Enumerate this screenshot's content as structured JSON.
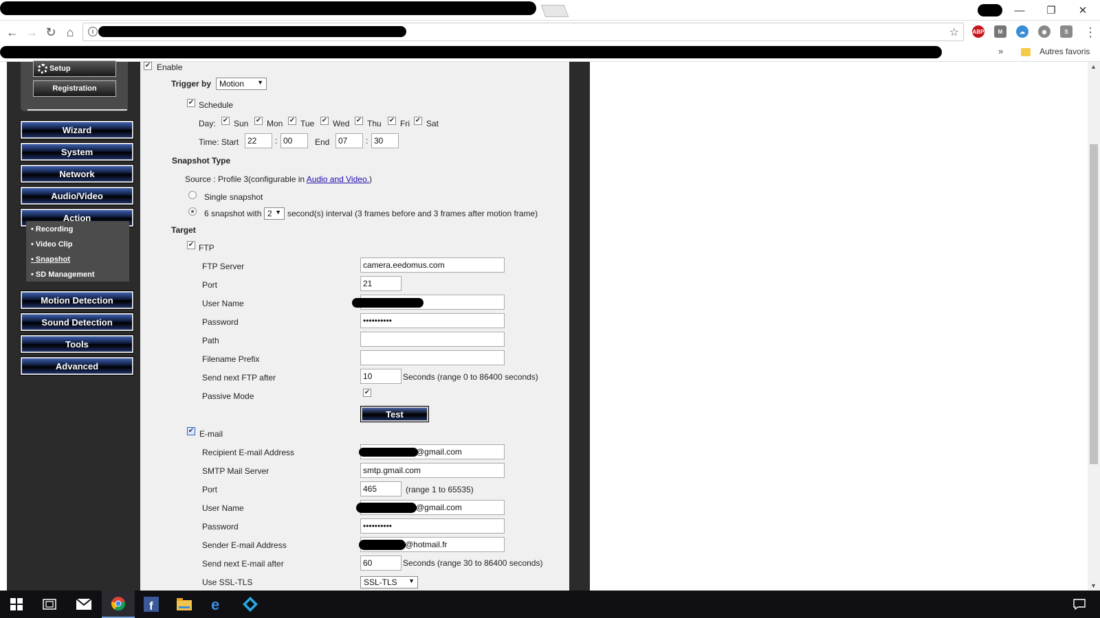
{
  "browser": {
    "bookmarks_more": "»",
    "bookmarks_folder_label": "Autres favoris",
    "window": {
      "minimize": "—",
      "restore": "❐",
      "close": "✕"
    },
    "nav": {
      "back": "←",
      "forward": "→",
      "reload": "↻",
      "home": "⌂",
      "star": "☆",
      "menu": "⋮"
    },
    "extensions": [
      {
        "name": "abp-icon",
        "text": "ABP",
        "color": "#c4161c"
      },
      {
        "name": "gmail-icon",
        "text": "M",
        "color": "#777777"
      },
      {
        "name": "cloud-icon",
        "text": "☁",
        "color": "#3a8ed6"
      },
      {
        "name": "eye-icon",
        "text": "◉",
        "color": "#888888"
      },
      {
        "name": "s-extension-icon",
        "text": "S",
        "color": "#8a8a8a"
      }
    ]
  },
  "sidebar": {
    "setup_label": "Setup",
    "registration_label": "Registration",
    "menu": [
      "Wizard",
      "System",
      "Network",
      "Audio/Video",
      "Action",
      "Motion Detection",
      "Sound Detection",
      "Tools",
      "Advanced"
    ],
    "submenu": [
      "Recording",
      "Video Clip",
      "Snapshot",
      "SD Management"
    ],
    "active_submenu": "Snapshot"
  },
  "form": {
    "enable_label": "Enable",
    "trigger_by_label": "Trigger by",
    "trigger_by_value": "Motion",
    "schedule_label": "Schedule",
    "day_label": "Day:",
    "days": [
      "Sun",
      "Mon",
      "Tue",
      "Wed",
      "Thu",
      "Fri",
      "Sat"
    ],
    "time_label": "Time: Start",
    "start_hour": "22",
    "start_min": "00",
    "end_label": "End",
    "end_hour": "07",
    "end_min": "30",
    "colon": ":",
    "snapshot_type_label": "Snapshot Type",
    "source_prefix": "Source : Profile 3(configurable in ",
    "source_link": "Audio and Video.",
    "source_suffix": ")",
    "single_snapshot_label": "Single snapshot",
    "multi_prefix": "6 snapshot with",
    "multi_value": "2",
    "multi_suffix": "second(s) interval (3 frames before and 3 frames after motion frame)",
    "target_label": "Target",
    "ftp": {
      "label": "FTP",
      "server_label": "FTP Server",
      "server_value": "camera.eedomus.com",
      "port_label": "Port",
      "port_value": "21",
      "user_label": "User Name",
      "password_label": "Password",
      "password_value": "••••••••••",
      "path_label": "Path",
      "prefix_label": "Filename Prefix",
      "send_next_label": "Send next FTP after",
      "send_next_value": "10",
      "send_next_hint": "Seconds  (range 0 to 86400 seconds)",
      "passive_label": "Passive Mode",
      "test_label": "Test"
    },
    "email": {
      "label": "E-mail",
      "recipient_label": "Recipient E-mail Address",
      "recipient_suffix": "@gmail.com",
      "smtp_label": "SMTP Mail Server",
      "smtp_value": "smtp.gmail.com",
      "port_label": "Port",
      "port_value": "465",
      "port_hint": "(range 1 to 65535)",
      "user_label": "User Name",
      "user_suffix": "@gmail.com",
      "password_label": "Password",
      "password_value": "••••••••••",
      "sender_label": "Sender E-mail Address",
      "sender_suffix": "@hotmail.fr",
      "send_next_label": "Send next E-mail after",
      "send_next_value": "60",
      "send_next_hint": "Seconds  (range 30 to 86400 seconds)",
      "ssl_label": "Use SSL-TLS",
      "ssl_value": "SSL-TLS"
    }
  },
  "taskbar": {
    "items": [
      "windows-start-icon",
      "task-view-icon",
      "mail-icon",
      "chrome-icon",
      "facebook-icon",
      "file-explorer-icon",
      "edge-icon",
      "kodi-icon"
    ],
    "notifications_icon": "action-center-icon"
  }
}
